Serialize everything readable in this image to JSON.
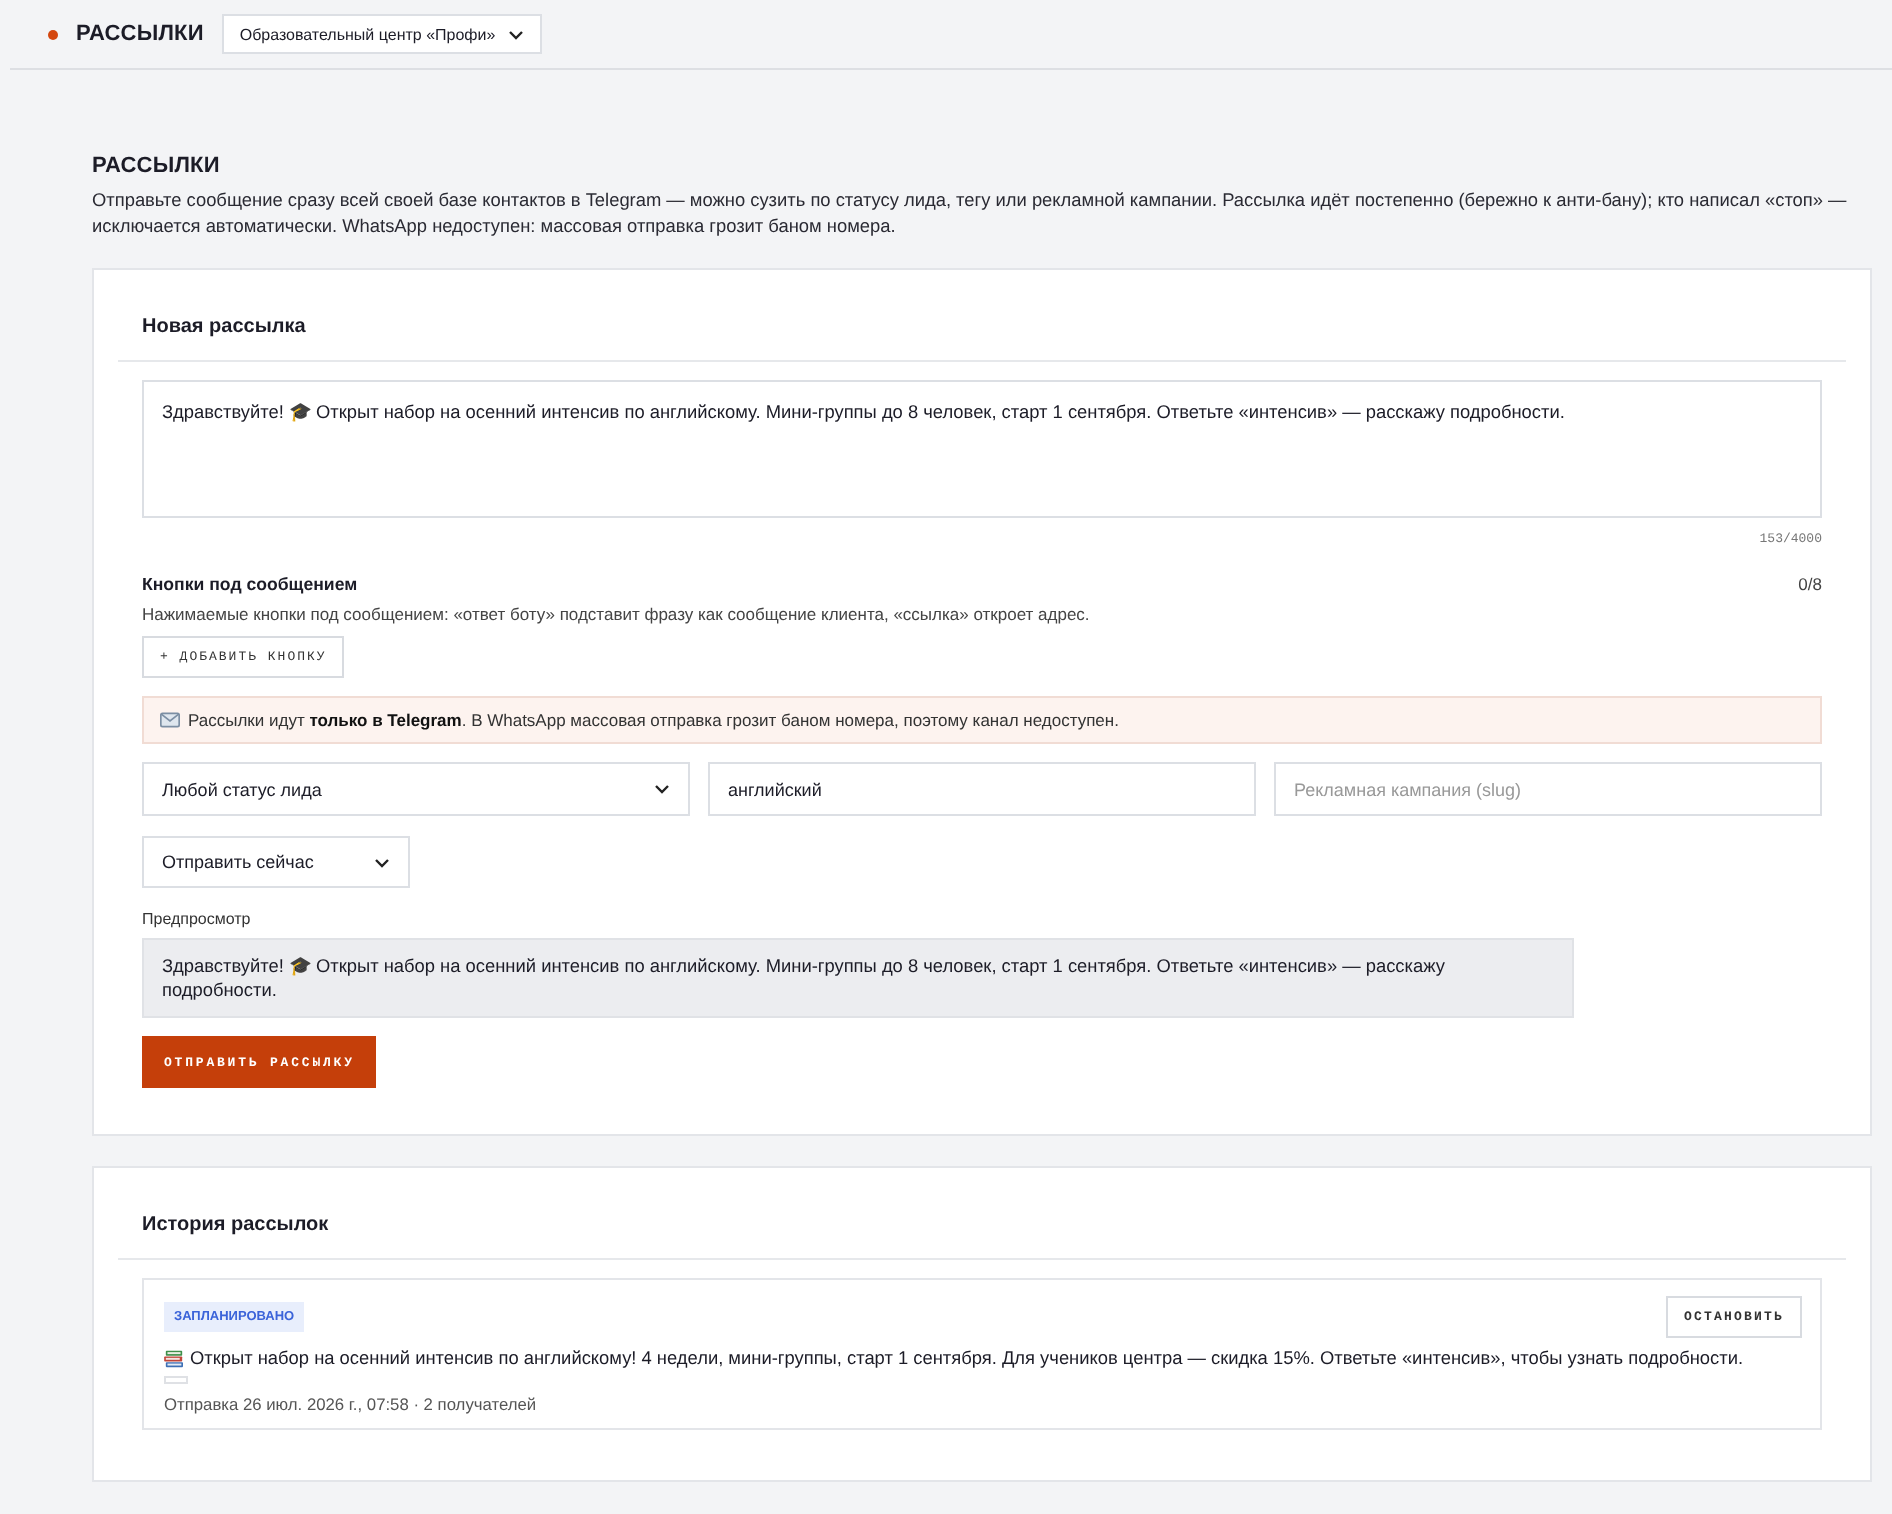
{
  "header": {
    "title": "РАССЫЛКИ",
    "org_select": {
      "value": "Образовательный центр «Профи»"
    }
  },
  "page": {
    "title": "РАССЫЛКИ",
    "description": "Отправьте сообщение сразу всей своей базе контактов в Telegram — можно сузить по статусу лида, тегу или рекламной кампании. Рассылка идёт постепенно (бережно к анти-бану); кто написал «стоп» — исключается автоматически. WhatsApp недоступен: массовая отправка грозит баном номера."
  },
  "new_broadcast": {
    "title": "Новая рассылка",
    "message": {
      "value": "Здравствуйте! 🎓 Открыт набор на осенний интенсив по английскому. Мини-группы до 8 человек, старт 1 сентября. Ответьте «интенсив» — расскажу подробности.",
      "counter": "153/4000"
    },
    "buttons_section": {
      "title": "Кнопки под сообщением",
      "count": "0/8",
      "hint": "Нажимаемые кнопки под сообщением: «ответ боту» подставит фразу как сообщение клиента, «ссылка» откроет адрес.",
      "add_button": "+ ДОБАВИТЬ КНОПКУ"
    },
    "notice": {
      "text": "Рассылки идут **только в Telegram**. В WhatsApp массовая отправка грозит баном номера, поэтому канал недоступен."
    },
    "filters": [
      {
        "kind": "select",
        "value": "Любой статус лида"
      },
      {
        "kind": "input",
        "value": "английский"
      },
      {
        "kind": "input",
        "placeholder": "Рекламная кампания (slug)"
      }
    ],
    "schedule_select": {
      "value": "Отправить сейчас"
    },
    "preview": {
      "label": "Предпросмотр",
      "text": "Здравствуйте! 🎓 Открыт набор на осенний интенсив по английскому. Мини-группы до 8 человек, старт 1 сентября. Ответьте «интенсив» — расскажу подробности."
    },
    "send_button": "ОТПРАВИТЬ РАССЫЛКУ"
  },
  "history": {
    "title": "История рассылок",
    "items": [
      {
        "status": {
          "label": "ЗАПЛАНИРОВАНО",
          "kind": "scheduled"
        },
        "text": "Открыт набор на осенний интенсив по английскому! 4 недели, мини-группы, старт 1 сентября. Для учеников центра — скидка 15%. Ответьте «интенсив», чтобы узнать подробности.",
        "stop_button": "ОСТАНОВИТЬ",
        "meta": "Отправка 26 июл. 2026 г., 07:58 · 2 получателей"
      }
    ]
  }
}
